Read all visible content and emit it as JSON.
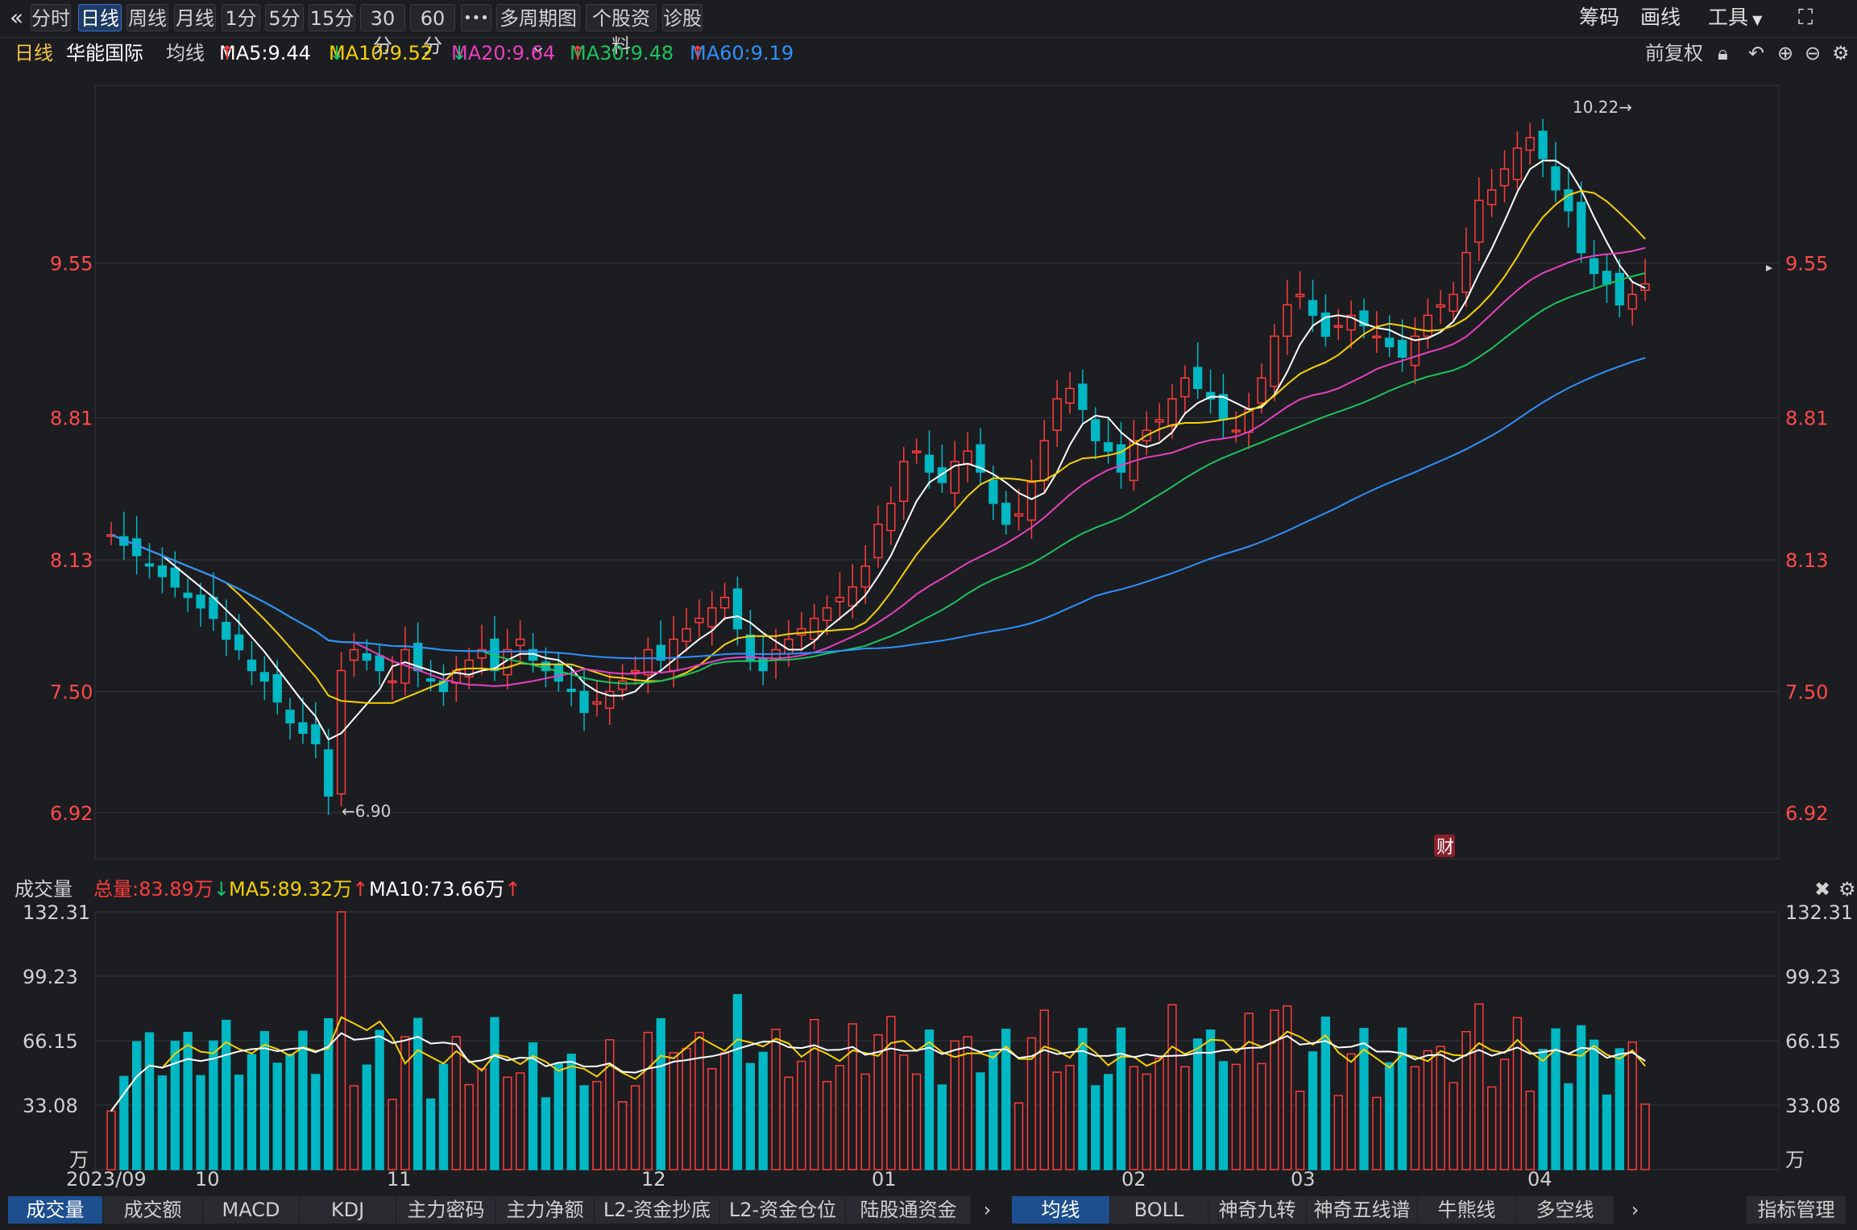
{
  "toolbar": {
    "back_icon": "«",
    "buttons": [
      {
        "label": "分时",
        "active": false
      },
      {
        "label": "日线",
        "active": true
      },
      {
        "label": "周线",
        "active": false
      },
      {
        "label": "月线",
        "active": false
      },
      {
        "label": "1分",
        "active": false
      },
      {
        "label": "5分",
        "active": false
      },
      {
        "label": "15分",
        "active": false
      },
      {
        "label": "30分",
        "active": false
      },
      {
        "label": "60分",
        "active": false
      },
      {
        "label": "•••",
        "active": false
      },
      {
        "label": "多周期图",
        "active": false
      },
      {
        "label": "个股资料",
        "active": false
      },
      {
        "label": "诊股",
        "active": false
      }
    ],
    "right": {
      "chouma": "筹码",
      "huaxian": "画线",
      "gongju": "工具"
    }
  },
  "info": {
    "period": "日线",
    "stock_name": "华能国际",
    "avg_label": "均线",
    "ma5": "MA5:9.44",
    "ma10": "MA10:9.52",
    "ma20": "MA20:9.64",
    "ma30": "MA30:9.48",
    "ma60": "MA60:9.19",
    "adjust": "前复权"
  },
  "volume_info": {
    "title": "成交量",
    "total": "总量:83.89万",
    "ma5": "MA5:89.32万",
    "ma10": "MA10:73.66万"
  },
  "colors": {
    "up": "#ff3b3b",
    "down": "#00b8c4",
    "ma5": "#ffffff",
    "ma10": "#f5d100",
    "ma20": "#e83fbf",
    "ma30": "#19c45b",
    "ma60": "#2e90ff"
  },
  "chart_data": [
    {
      "type": "candlestick",
      "yticks": [
        "9.55",
        "8.81",
        "8.13",
        "7.50",
        "6.92"
      ],
      "annotations": {
        "high": "10.22→",
        "low": "←6.90",
        "fin_badge": "财"
      },
      "ylim": [
        6.7,
        10.4
      ],
      "x_labels": [
        "2023/09",
        "10",
        "11",
        "12",
        "01",
        "02",
        "03",
        "04"
      ],
      "series_close": [
        8.25,
        8.2,
        8.15,
        8.1,
        8.05,
        8.0,
        7.95,
        7.9,
        7.85,
        7.75,
        7.7,
        7.6,
        7.55,
        7.45,
        7.35,
        7.3,
        7.25,
        7.0,
        7.6,
        7.7,
        7.65,
        7.6,
        7.55,
        7.7,
        7.6,
        7.55,
        7.5,
        7.6,
        7.65,
        7.7,
        7.6,
        7.7,
        7.75,
        7.65,
        7.6,
        7.55,
        7.5,
        7.4,
        7.45,
        7.5,
        7.55,
        7.6,
        7.7,
        7.65,
        7.75,
        7.8,
        7.85,
        7.9,
        7.95,
        7.8,
        7.65,
        7.6,
        7.7,
        7.75,
        7.8,
        7.85,
        7.9,
        7.95,
        8.0,
        8.1,
        8.3,
        8.4,
        8.6,
        8.65,
        8.55,
        8.5,
        8.6,
        8.65,
        8.55,
        8.4,
        8.3,
        8.35,
        8.5,
        8.7,
        8.9,
        8.95,
        8.85,
        8.7,
        8.65,
        8.55,
        8.7,
        8.75,
        8.8,
        8.9,
        9.0,
        8.95,
        8.9,
        8.8,
        8.75,
        8.85,
        9.0,
        9.2,
        9.35,
        9.4,
        9.3,
        9.2,
        9.25,
        9.3,
        9.25,
        9.2,
        9.15,
        9.1,
        9.2,
        9.3,
        9.35,
        9.4,
        9.6,
        9.85,
        9.9,
        10.0,
        10.1,
        10.15,
        10.05,
        9.9,
        9.8,
        9.6,
        9.5,
        9.45,
        9.35,
        9.4,
        9.45
      ],
      "volume_yticks": [
        "132.31",
        "99.23",
        "66.15",
        "33.08",
        "万"
      ],
      "volume_ylim": [
        0,
        132.31
      ]
    }
  ],
  "bottom_tabs_left": [
    "成交量",
    "成交额",
    "MACD",
    "KDJ",
    "主力密码",
    "主力净额",
    "L2-资金抄底",
    "L2-资金仓位",
    "陆股通资金"
  ],
  "bottom_tabs_right": [
    "均线",
    "BOLL",
    "神奇九转",
    "神奇五线谱",
    "牛熊线",
    "多空线"
  ],
  "indicator_manage": "指标管理"
}
